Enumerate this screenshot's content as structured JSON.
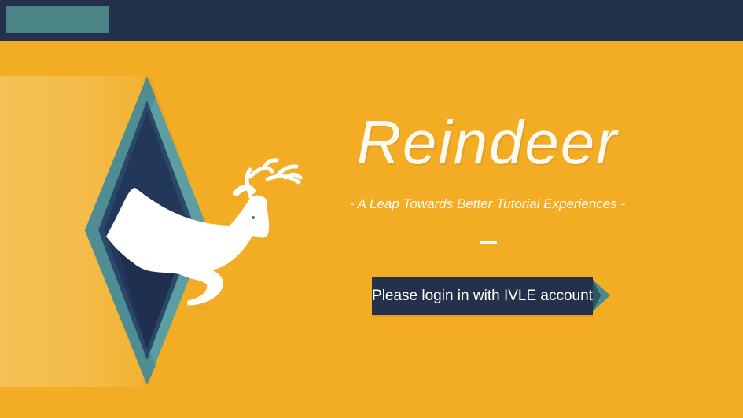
{
  "header": {
    "logo_name": "app-logo",
    "colors": {
      "bar": "#24314d",
      "logo": "#4a8486"
    }
  },
  "hero": {
    "title": "Reindeer",
    "subtitle": "- A Leap Towards Better Tutorial Experiences -",
    "separator": "—",
    "illustration": {
      "name": "reindeer-leaping-from-portal",
      "colors": {
        "background": "#f3ad25",
        "portal_outer": "#5a9ca1",
        "portal_inner": "#22375a",
        "deer": "#ffffff"
      }
    }
  },
  "actions": {
    "login_label": "Please login in with IVLE account",
    "login_color": "#25304b",
    "arrow_color": "#4b8a90"
  }
}
